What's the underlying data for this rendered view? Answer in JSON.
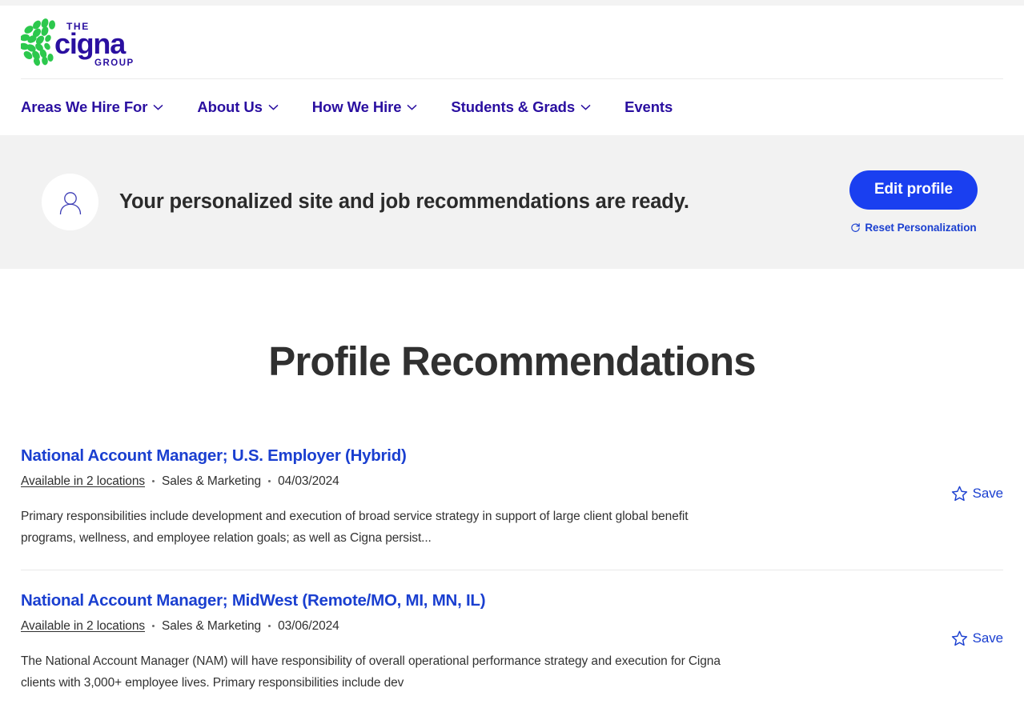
{
  "brand": {
    "logo_name": "the-cigna-group-logo",
    "logo_top_text": "THE",
    "logo_main_text": "Cigna",
    "logo_bottom_text": "GROUP",
    "navy": "#2a0fa0",
    "green": "#2cc84d",
    "accent_blue": "#1a3ff0",
    "link_blue": "#1a3fd0"
  },
  "nav": {
    "items": [
      {
        "label": "Areas We Hire For",
        "has_dropdown": true
      },
      {
        "label": "About Us",
        "has_dropdown": true
      },
      {
        "label": "How We Hire",
        "has_dropdown": true
      },
      {
        "label": "Students & Grads",
        "has_dropdown": true
      },
      {
        "label": "Events",
        "has_dropdown": false
      }
    ]
  },
  "banner": {
    "avatar_icon": "person-icon",
    "headline": "Your personalized site and job recommendations are ready.",
    "edit_profile_label": "Edit profile",
    "reset_label": "Reset Personalization",
    "reset_icon": "refresh-icon",
    "background": "#f2f2f2"
  },
  "main": {
    "page_title": "Profile Recommendations",
    "save_label": "Save",
    "save_icon": "star-outline-icon",
    "jobs": [
      {
        "title": "National Account Manager; U.S. Employer (Hybrid)",
        "locations": "Available in 2 locations",
        "category": "Sales & Marketing",
        "date": "04/03/2024",
        "description": "Primary responsibilities include development and execution of broad service strategy in support of large client global benefit programs, wellness, and employee relation goals; as well as Cigna persist..."
      },
      {
        "title": "National Account Manager; MidWest (Remote/MO, MI, MN, IL)",
        "locations": "Available in 2 locations",
        "category": "Sales & Marketing",
        "date": "03/06/2024",
        "description": "The National Account Manager (NAM) will have responsibility of overall operational performance strategy and execution for Cigna clients with 3,000+ employee lives. Primary responsibilities include dev"
      }
    ]
  }
}
